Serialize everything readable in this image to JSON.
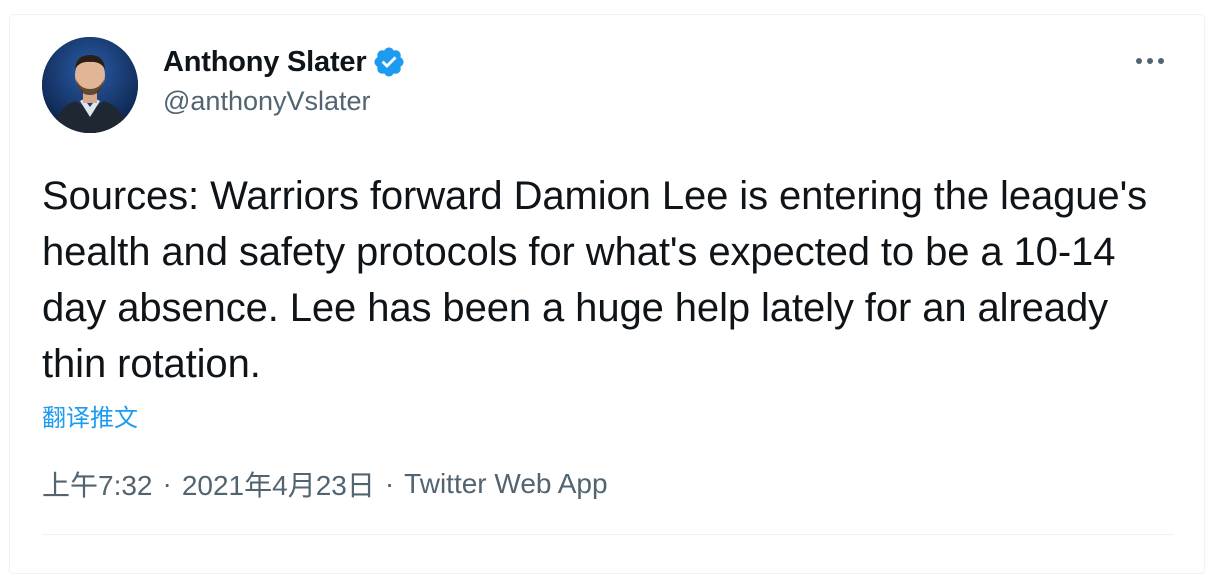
{
  "author": {
    "display_name": "Anthony Slater",
    "handle": "@anthonyVslater",
    "verified_icon": "verified-badge-icon",
    "avatar_icon": "avatar-photo"
  },
  "tweet": {
    "text": "Sources: Warriors forward Damion Lee is entering the league's health and safety protocols for what's expected to be a 10-14 day absence. Lee has been a huge help lately for an already thin rotation.",
    "translate_label": "翻译推文"
  },
  "meta": {
    "time": "上午7:32",
    "separator": "·",
    "date": "2021年4月23日",
    "source": "Twitter Web App"
  },
  "menu": {
    "more_icon": "more-horizontal-icon"
  },
  "colors": {
    "text_primary": "#0f1419",
    "text_secondary": "#536471",
    "accent": "#1d9bf0",
    "border": "#eff3f4"
  }
}
